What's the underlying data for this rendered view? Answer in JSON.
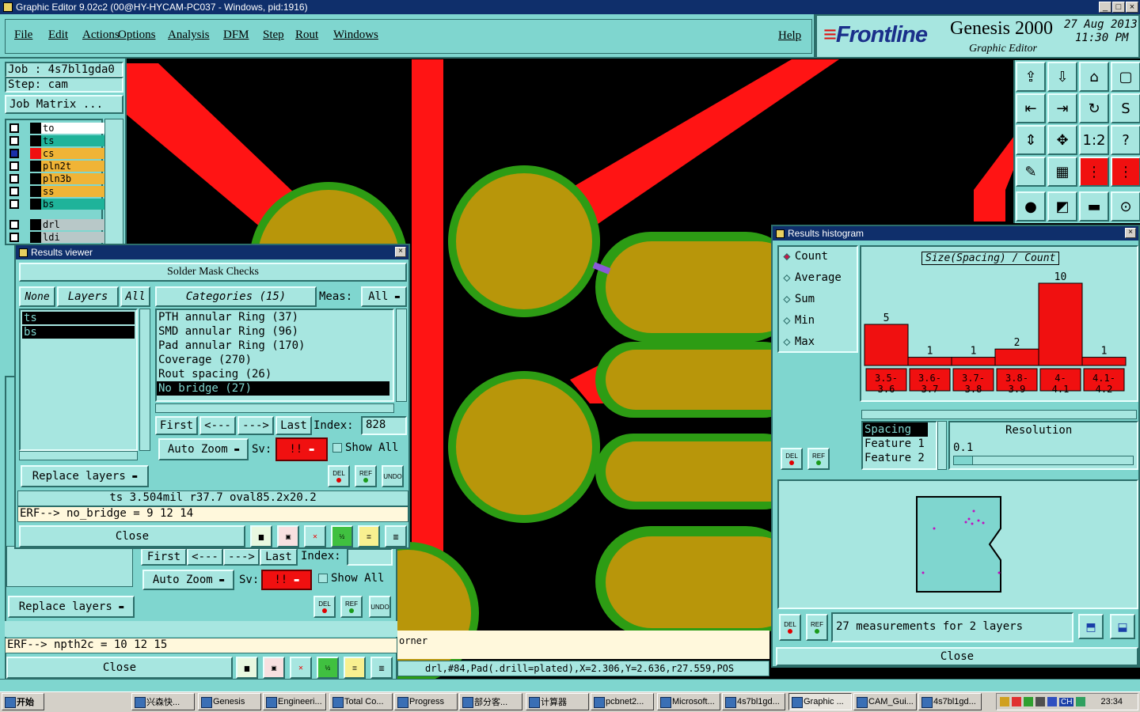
{
  "window": {
    "title": "Graphic Editor 9.02c2 (00@HY-HYCAM-PC037 - Windows, pid:1916)"
  },
  "menu": [
    "File",
    "Edit",
    "Actions",
    "Options",
    "Analysis",
    "DFM",
    "Step",
    "Rout",
    "Windows"
  ],
  "help": "Help",
  "brand": {
    "logo": "Frontline",
    "product": "Genesis 2000",
    "subtitle": "Graphic Editor",
    "date": "27 Aug 2013",
    "time": "11:30 PM"
  },
  "job": {
    "job_label": "Job : 4s7bl1gda0",
    "step_label": "Step: cam",
    "matrix_button": "Job Matrix ..."
  },
  "layers": [
    {
      "name": "to",
      "color": "#ffffff"
    },
    {
      "name": "ts",
      "color": "#1fb39a"
    },
    {
      "name": "cs",
      "color": "#f0b436"
    },
    {
      "name": "pln2t",
      "color": "#f0b436"
    },
    {
      "name": "pln3b",
      "color": "#f0b436"
    },
    {
      "name": "ss",
      "color": "#f0b436"
    },
    {
      "name": "bs",
      "color": "#1fb39a"
    },
    {
      "name": "drl",
      "color": "#b8c8c8"
    },
    {
      "name": "ldi",
      "color": "#b8c8c8"
    }
  ],
  "results_viewer": {
    "title": "Results viewer",
    "header": "Solder Mask Checks",
    "tabs": {
      "none": "None",
      "layers": "Layers",
      "all": "All",
      "categories": "Categories (15)",
      "meas": "Meas:",
      "meas_value": "All"
    },
    "layer_list": [
      "ts",
      "bs"
    ],
    "categories": [
      "PTH annular Ring (37)",
      "SMD annular Ring (96)",
      "Pad annular Ring (170)",
      "Coverage (270)",
      "Rout spacing (26)",
      "No bridge (27)"
    ],
    "nav": {
      "first": "First",
      "prev": "<---",
      "next": "--->",
      "last": "Last",
      "index_label": "Index:",
      "index_value": "828"
    },
    "auto_zoom": "Auto Zoom",
    "sv": "Sv:",
    "sv_value": "!!",
    "show_all": "Show All",
    "replace_layers": "Replace layers",
    "del": "DEL",
    "ref": "REF",
    "undo": "UNDO",
    "info": "ts 3.504mil   r37.7   oval85.2x20.2",
    "erf": "ERF--> no_bridge = 9 12 14",
    "close": "Close"
  },
  "back_viewer": {
    "nav": {
      "first": "First",
      "prev": "<---",
      "next": "--->",
      "last": "Last",
      "index_label": "Index:"
    },
    "auto_zoom": "Auto Zoom",
    "sv": "Sv:",
    "sv_value": "!!",
    "show_all": "Show All",
    "replace_layers": "Replace layers",
    "del": "DEL",
    "ref": "REF",
    "undo": "UNDO",
    "erf": "ERF--> npth2c = 10 12 15",
    "close": "Close"
  },
  "status_bar": {
    "left": "orner",
    "coords": "drl,#84,Pad(.drill=plated),X=2.306,Y=2.636,r27.559,POS"
  },
  "histogram": {
    "title": "Results histogram",
    "modes": [
      "Count",
      "Average",
      "Sum",
      "Min",
      "Max"
    ],
    "selected_mode": "Count",
    "chart_title": "Size(Spacing) / Count",
    "del": "DEL",
    "ref": "REF",
    "spacing_list": [
      "Spacing",
      "Feature 1",
      "Feature 2"
    ],
    "resolution_label": "Resolution",
    "resolution_value": "0.1",
    "measurements": "27 measurements for 2 layers",
    "close": "Close"
  },
  "chart_data": {
    "type": "bar",
    "title": "Size(Spacing) / Count",
    "categories": [
      "3.5-3.6",
      "3.6-3.7",
      "3.7-3.8",
      "3.8-3.9",
      "4-4.1",
      "4.1-4.2"
    ],
    "values": [
      5,
      1,
      1,
      2,
      10,
      1
    ],
    "ylim": [
      0,
      10
    ],
    "bar_color": "#f01010"
  },
  "taskbar": {
    "start": "开始",
    "items": [
      "兴森快...",
      "Genesis",
      "Engineeri...",
      "Total Co...",
      "Progress",
      "部分客...",
      "计算器",
      "pcbnet2...",
      "Microsoft...",
      "4s7bl1gd...",
      "Graphic ...",
      "CAM_Gui...",
      "4s7bl1gd..."
    ],
    "lang": "CH",
    "clock": "23:34"
  }
}
